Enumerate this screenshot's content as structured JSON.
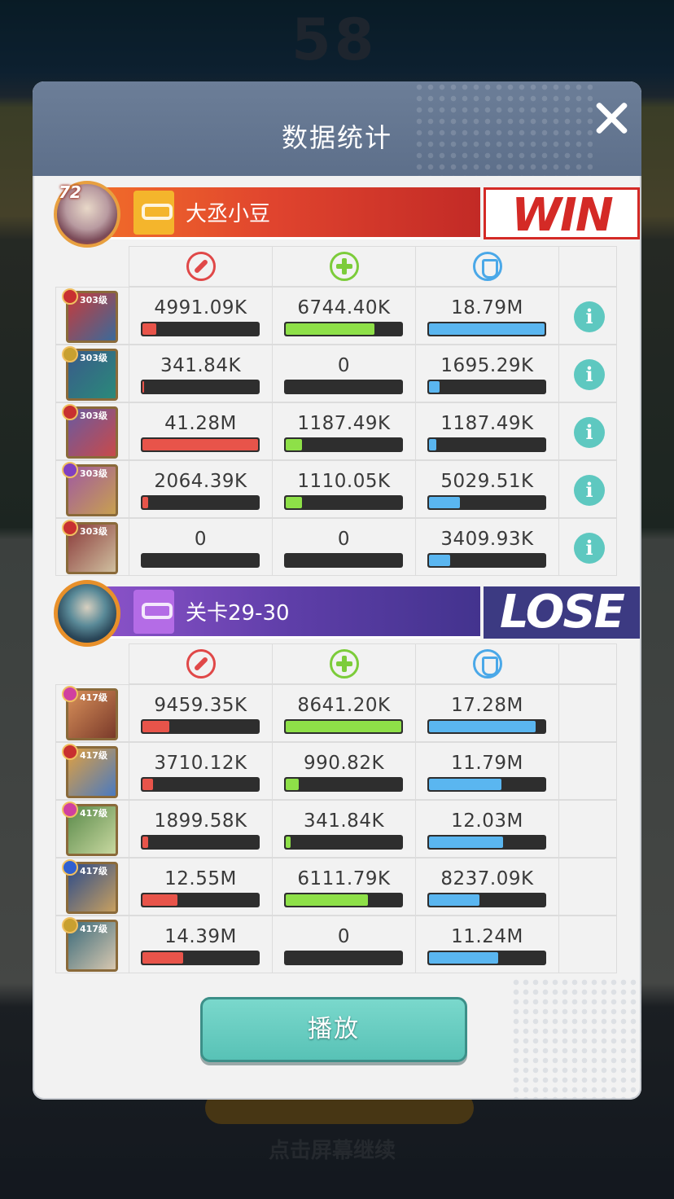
{
  "background": {
    "score": "58",
    "bottom_hint": "点击屏幕继续"
  },
  "dialog": {
    "title": "数据统计",
    "play_label": "播放"
  },
  "stat_icons": [
    "damage-icon",
    "heal-icon",
    "shield-icon"
  ],
  "colors": {
    "damage": "#e8544a",
    "heal": "#8ee048",
    "shield": "#5ab6f0",
    "win": "#d42a26",
    "lose": "#3c3a82"
  },
  "team1": {
    "name": "大丞小豆",
    "result": "WIN",
    "level": "72",
    "heroes": [
      {
        "level": "303级",
        "damage": "4991.09K",
        "heal": "6744.40K",
        "shield": "18.79M",
        "damage_pct": 12,
        "heal_pct": 77,
        "shield_pct": 100
      },
      {
        "level": "303级",
        "damage": "341.84K",
        "heal": "0",
        "shield": "1695.29K",
        "damage_pct": 1,
        "heal_pct": 0,
        "shield_pct": 9
      },
      {
        "level": "303级",
        "damage": "41.28M",
        "heal": "1187.49K",
        "shield": "1187.49K",
        "damage_pct": 100,
        "heal_pct": 14,
        "shield_pct": 6
      },
      {
        "level": "303级",
        "damage": "2064.39K",
        "heal": "1110.05K",
        "shield": "5029.51K",
        "damage_pct": 5,
        "heal_pct": 14,
        "shield_pct": 27
      },
      {
        "level": "303级",
        "damage": "0",
        "heal": "0",
        "shield": "3409.93K",
        "damage_pct": 0,
        "heal_pct": 0,
        "shield_pct": 18
      }
    ]
  },
  "team2": {
    "name": "关卡29-30",
    "result": "LOSE",
    "heroes": [
      {
        "level": "417级",
        "damage": "9459.35K",
        "heal": "8641.20K",
        "shield": "17.28M",
        "damage_pct": 23,
        "heal_pct": 100,
        "shield_pct": 92
      },
      {
        "level": "417级",
        "damage": "3710.12K",
        "heal": "990.82K",
        "shield": "11.79M",
        "damage_pct": 9,
        "heal_pct": 11,
        "shield_pct": 63
      },
      {
        "level": "417级",
        "damage": "1899.58K",
        "heal": "341.84K",
        "shield": "12.03M",
        "damage_pct": 5,
        "heal_pct": 4,
        "shield_pct": 64
      },
      {
        "level": "417级",
        "damage": "12.55M",
        "heal": "6111.79K",
        "shield": "8237.09K",
        "damage_pct": 30,
        "heal_pct": 71,
        "shield_pct": 44
      },
      {
        "level": "417级",
        "damage": "14.39M",
        "heal": "0",
        "shield": "11.24M",
        "damage_pct": 35,
        "heal_pct": 0,
        "shield_pct": 60
      }
    ]
  }
}
